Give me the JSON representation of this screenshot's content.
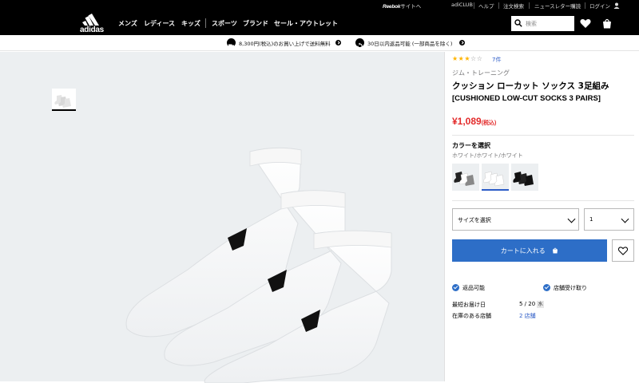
{
  "util_bar": {
    "reebok_brand": "Reebok",
    "reebok_site": "サイトへ",
    "links": [
      "adiCLUB",
      "ヘルプ",
      "注文検索",
      "ニュースレター購読",
      "ログイン"
    ]
  },
  "nav": {
    "logo_text": "adidas",
    "items": [
      "メンズ",
      "レディース",
      "キッズ",
      "スポーツ",
      "ブランド",
      "セール・アウトレット"
    ],
    "search_placeholder": "検索"
  },
  "promo": {
    "shipping": "8,300円(税込)のお買い上げで送料無料",
    "returns": "30日以内返品可能 (一部商品を除く)"
  },
  "product": {
    "rating_stars_filled": 3,
    "rating_stars_total": 5,
    "review_count": "7件",
    "category": "ジム・トレーニング",
    "title_jp": "クッション ローカット ソックス 3足組み",
    "title_en": "[CUSHIONED LOW-CUT SOCKS 3 PAIRS]",
    "price": "¥1,089",
    "price_tax": "(税込)",
    "color_label": "カラーを選択",
    "color_name": "ホワイト/ホワイト/ホワイト",
    "swatches": [
      "black-white-grey",
      "white",
      "black"
    ],
    "size_placeholder": "サイズを選択",
    "quantity": "1",
    "add_to_cart": "カートに入れる",
    "features": [
      "返品可能",
      "店舗受け取り"
    ],
    "delivery_label": "最短お届け日",
    "delivery_date": "5 / 20",
    "delivery_weekday": "水",
    "store_label": "在庫のある店舗",
    "store_count": "2 店舗"
  },
  "colors": {
    "accent": "#2d6ec7",
    "price": "#e32b2b",
    "star": "#ffb400",
    "gallery_bg": "#eceff1"
  }
}
